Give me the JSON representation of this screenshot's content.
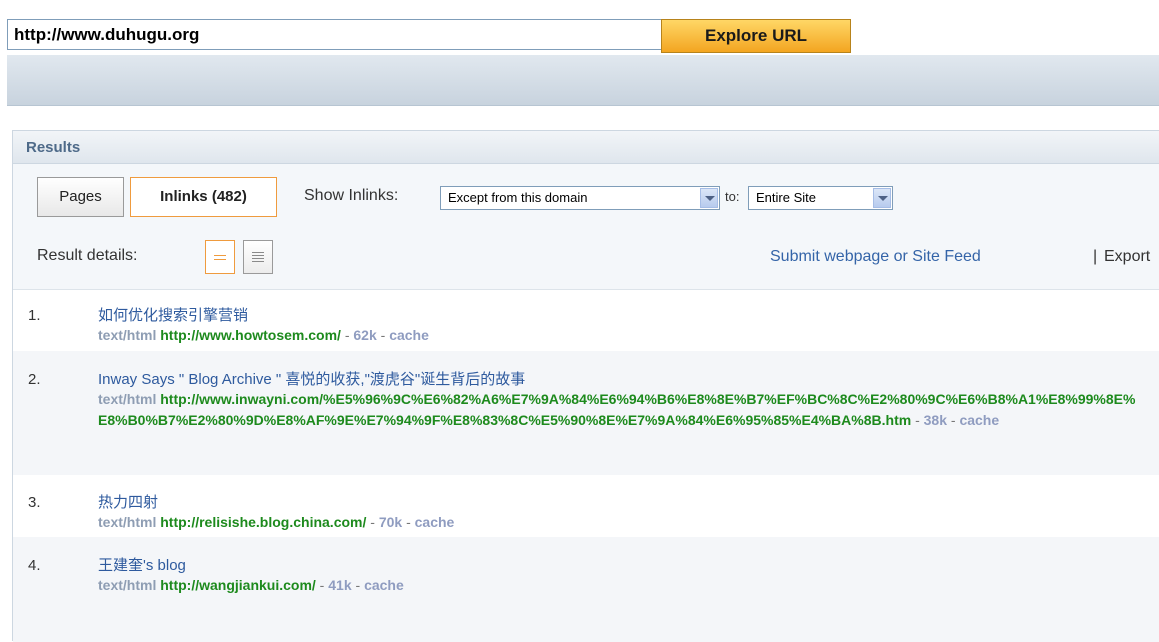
{
  "search": {
    "url_value": "http://www.duhugu.org",
    "explore_label": "Explore URL"
  },
  "results_panel": {
    "header": "Results",
    "tabs": [
      {
        "label": "Pages"
      },
      {
        "label": "Inlinks (482)"
      }
    ],
    "show_inlinks_label": "Show Inlinks:",
    "domain_select_value": "Except from this domain",
    "to_label": "to:",
    "site_select_value": "Entire Site",
    "result_details_label": "Result details:",
    "submit_link": "Submit webpage or Site Feed",
    "separator": "|",
    "export_link": "Export"
  },
  "results": [
    {
      "num": "1.",
      "title": "如何优化搜索引擎营销",
      "mime": "text/html",
      "url": "http://www.howtosem.com/",
      "size": "62k",
      "cache": "cache"
    },
    {
      "num": "2.",
      "title": "Inway Says \" Blog Archive \" 喜悦的收获,\"渡虎谷\"诞生背后的故事",
      "mime": "text/html",
      "url": "http://www.inwayni.com/%E5%96%9C%E6%82%A6%E7%9A%84%E6%94%B6%E8%8E%B7%EF%BC%8C%E2%80%9C%E6%B8%A1%E8%99%8E%E8%B0%B7%E2%80%9D%E8%AF%9E%E7%94%9F%E8%83%8C%E5%90%8E%E7%9A%84%E6%95%85%E4%BA%8B.htm",
      "size": "38k",
      "cache": "cache"
    },
    {
      "num": "3.",
      "title": "热力四射",
      "mime": "text/html",
      "url": "http://relisishe.blog.china.com/",
      "size": "70k",
      "cache": "cache"
    },
    {
      "num": "4.",
      "title": "王建奎's blog",
      "mime": "text/html",
      "url": "http://wangjiankui.com/",
      "size": "41k",
      "cache": "cache"
    }
  ],
  "meta_separator": " - "
}
